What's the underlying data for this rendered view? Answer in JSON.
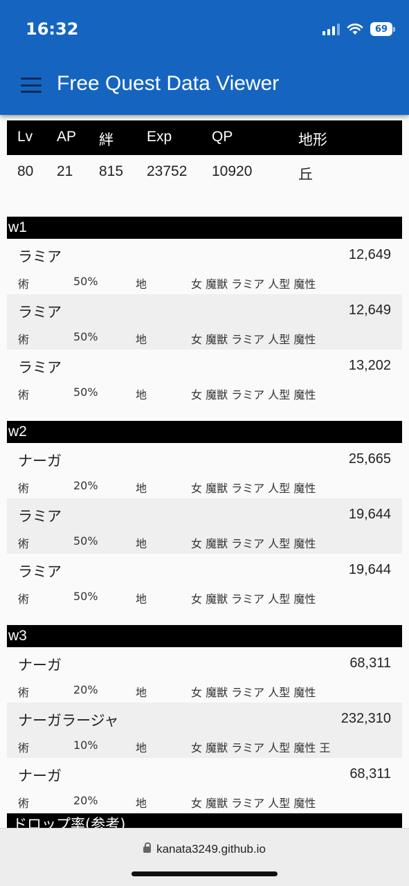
{
  "status_bar": {
    "time": "16:32",
    "battery": "69"
  },
  "app": {
    "title": "Free Quest Data Viewer"
  },
  "quest_info": {
    "headers": [
      "Lv",
      "AP",
      "絆",
      "Exp",
      "QP",
      "地形"
    ],
    "values": [
      "80",
      "21",
      "815",
      "23752",
      "10920",
      "丘"
    ]
  },
  "waves": [
    {
      "label": "w1",
      "enemies": [
        {
          "name": "ラミア",
          "hp": "12,649",
          "class": "術",
          "rate": "50%",
          "attribute": "地",
          "traits": "女 魔獣 ラミア 人型 魔性"
        },
        {
          "name": "ラミア",
          "hp": "12,649",
          "class": "術",
          "rate": "50%",
          "attribute": "地",
          "traits": "女 魔獣 ラミア 人型 魔性"
        },
        {
          "name": "ラミア",
          "hp": "13,202",
          "class": "術",
          "rate": "50%",
          "attribute": "地",
          "traits": "女 魔獣 ラミア 人型 魔性"
        }
      ]
    },
    {
      "label": "w2",
      "enemies": [
        {
          "name": "ナーガ",
          "hp": "25,665",
          "class": "術",
          "rate": "20%",
          "attribute": "地",
          "traits": "女 魔獣 ラミア 人型 魔性"
        },
        {
          "name": "ラミア",
          "hp": "19,644",
          "class": "術",
          "rate": "50%",
          "attribute": "地",
          "traits": "女 魔獣 ラミア 人型 魔性"
        },
        {
          "name": "ラミア",
          "hp": "19,644",
          "class": "術",
          "rate": "50%",
          "attribute": "地",
          "traits": "女 魔獣 ラミア 人型 魔性"
        }
      ]
    },
    {
      "label": "w3",
      "enemies": [
        {
          "name": "ナーガ",
          "hp": "68,311",
          "class": "術",
          "rate": "20%",
          "attribute": "地",
          "traits": "女 魔獣 ラミア 人型 魔性"
        },
        {
          "name": "ナーガラージャ",
          "hp": "232,310",
          "class": "術",
          "rate": "10%",
          "attribute": "地",
          "traits": "女 魔獣 ラミア 人型 魔性 王"
        },
        {
          "name": "ナーガ",
          "hp": "68,311",
          "class": "術",
          "rate": "20%",
          "attribute": "地",
          "traits": "女 魔獣 ラミア 人型 魔性"
        }
      ]
    }
  ],
  "drop_section": {
    "label": "ドロップ率(参考)"
  },
  "browser": {
    "url": "kanata3249.github.io"
  }
}
